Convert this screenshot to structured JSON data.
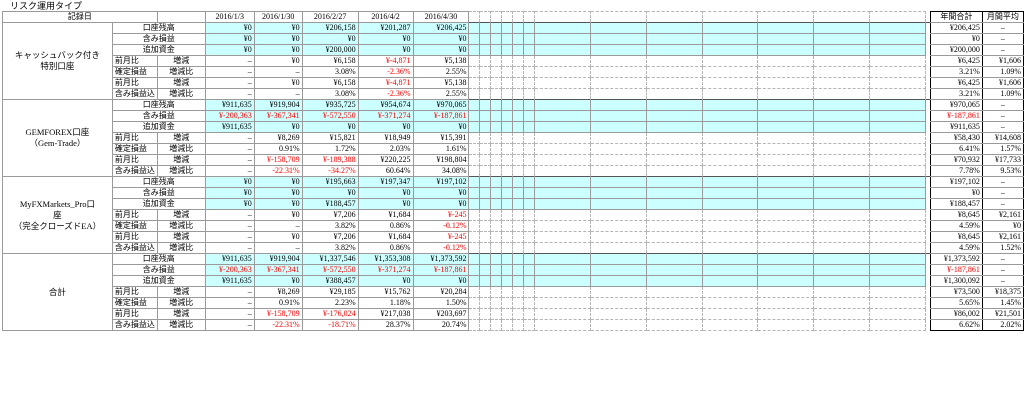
{
  "sheet_title": "リスク運用タイプ",
  "header": {
    "record_date_label": "記録日",
    "dates": [
      "2016/1/3",
      "2016/1/30",
      "2016/2/27",
      "2016/4/2",
      "2016/4/30"
    ],
    "annual_total": "年間合計",
    "monthly_avg": "月間平均"
  },
  "groups": [
    {
      "name": "キャッシュバック付き\n特別口座",
      "rows": [
        {
          "label": "口座残高",
          "cells": [
            "¥0",
            "¥0",
            "¥206,158",
            "¥201,287",
            "¥206,425"
          ],
          "total": "¥206,425",
          "avg": "–"
        },
        {
          "label": "含み損益",
          "cells": [
            "¥0",
            "¥0",
            "¥0",
            "¥0",
            "¥0"
          ],
          "total": "¥0",
          "avg": "–"
        },
        {
          "label": "追加資金",
          "cells": [
            "¥0",
            "¥0",
            "¥200,000",
            "¥0",
            "¥0"
          ],
          "total": "¥200,000",
          "avg": "–"
        },
        {
          "l1": "前月比",
          "l2": "増減",
          "cells": [
            "–",
            "¥0",
            "¥6,158",
            "¥-4,871",
            "¥5,138"
          ],
          "total": "¥6,425",
          "avg": "¥1,606"
        },
        {
          "l1": "確定損益",
          "l2": "増減比",
          "cells": [
            "–",
            "–",
            "3.08%",
            "-2.36%",
            "2.55%"
          ],
          "total": "3.21%",
          "avg": "1.09%"
        },
        {
          "l1": "前月比",
          "l2": "増減",
          "cells": [
            "–",
            "¥0",
            "¥6,158",
            "¥-4,871",
            "¥5,138"
          ],
          "total": "¥6,425",
          "avg": "¥1,606"
        },
        {
          "l1": "含み損益込",
          "l2": "増減比",
          "cells": [
            "–",
            "–",
            "3.08%",
            "-2.36%",
            "2.55%"
          ],
          "total": "3.21%",
          "avg": "1.09%"
        }
      ]
    },
    {
      "name": "GEMFOREX口座\n（Gem-Trade）",
      "rows": [
        {
          "label": "口座残高",
          "cells": [
            "¥911,635",
            "¥919,904",
            "¥935,725",
            "¥954,674",
            "¥970,065"
          ],
          "total": "¥970,065",
          "avg": "–"
        },
        {
          "label": "含み損益",
          "cells": [
            "¥-200,363",
            "¥-367,341",
            "¥-572,550",
            "¥-371,274",
            "¥-187,861"
          ],
          "total": "¥-187,861",
          "avg": "–"
        },
        {
          "label": "追加資金",
          "cells": [
            "¥911,635",
            "¥0",
            "¥0",
            "¥0",
            "¥0"
          ],
          "total": "¥911,635",
          "avg": "–"
        },
        {
          "l1": "前月比",
          "l2": "増減",
          "cells": [
            "–",
            "¥8,269",
            "¥15,821",
            "¥18,949",
            "¥15,391"
          ],
          "total": "¥58,430",
          "avg": "¥14,608"
        },
        {
          "l1": "確定損益",
          "l2": "増減比",
          "cells": [
            "–",
            "0.91%",
            "1.72%",
            "2.03%",
            "1.61%"
          ],
          "total": "6.41%",
          "avg": "1.57%"
        },
        {
          "l1": "前月比",
          "l2": "増減",
          "cells": [
            "–",
            "¥-158,709",
            "¥-189,388",
            "¥220,225",
            "¥198,804"
          ],
          "total": "¥70,932",
          "avg": "¥17,733"
        },
        {
          "l1": "含み損益込",
          "l2": "増減比",
          "cells": [
            "–",
            "-22.31%",
            "-34.27%",
            "60.64%",
            "34.08%"
          ],
          "total": "7.78%",
          "avg": "9.53%"
        }
      ]
    },
    {
      "name": "MyFXMarkets_Pro口\n座\n（完全クローズドEA）",
      "rows": [
        {
          "label": "口座残高",
          "cells": [
            "¥0",
            "¥0",
            "¥195,663",
            "¥197,347",
            "¥197,102"
          ],
          "total": "¥197,102",
          "avg": "–"
        },
        {
          "label": "含み損益",
          "cells": [
            "¥0",
            "¥0",
            "¥0",
            "¥0",
            "¥0"
          ],
          "total": "¥0",
          "avg": "–"
        },
        {
          "label": "追加資金",
          "cells": [
            "¥0",
            "¥0",
            "¥188,457",
            "¥0",
            "¥0"
          ],
          "total": "¥188,457",
          "avg": "–"
        },
        {
          "l1": "前月比",
          "l2": "増減",
          "cells": [
            "–",
            "¥0",
            "¥7,206",
            "¥1,684",
            "¥-245"
          ],
          "total": "¥8,645",
          "avg": "¥2,161"
        },
        {
          "l1": "確定損益",
          "l2": "増減比",
          "cells": [
            "–",
            "–",
            "3.82%",
            "0.86%",
            "-0.12%"
          ],
          "total": "4.59%",
          "avg": "¥0"
        },
        {
          "l1": "前月比",
          "l2": "増減",
          "cells": [
            "–",
            "¥0",
            "¥7,206",
            "¥1,684",
            "¥-245"
          ],
          "total": "¥8,645",
          "avg": "¥2,161"
        },
        {
          "l1": "含み損益込",
          "l2": "増減比",
          "cells": [
            "–",
            "–",
            "3.82%",
            "0.86%",
            "-0.12%"
          ],
          "total": "4.59%",
          "avg": "1.52%"
        }
      ]
    },
    {
      "name": "合計",
      "rows": [
        {
          "label": "口座残高",
          "cells": [
            "¥911,635",
            "¥919,904",
            "¥1,337,546",
            "¥1,353,308",
            "¥1,373,592"
          ],
          "total": "¥1,373,592",
          "avg": "–"
        },
        {
          "label": "含み損益",
          "cells": [
            "¥-200,363",
            "¥-367,341",
            "¥-572,550",
            "¥-371,274",
            "¥-187,861"
          ],
          "total": "¥-187,861",
          "avg": "–"
        },
        {
          "label": "追加資金",
          "cells": [
            "¥911,635",
            "¥0",
            "¥388,457",
            "¥0",
            "¥0"
          ],
          "total": "¥1,300,092",
          "avg": "–"
        },
        {
          "l1": "前月比",
          "l2": "増減",
          "cells": [
            "–",
            "¥8,269",
            "¥29,185",
            "¥15,762",
            "¥20,284"
          ],
          "total": "¥73,500",
          "avg": "¥18,375"
        },
        {
          "l1": "確定損益",
          "l2": "増減比",
          "cells": [
            "–",
            "0.91%",
            "2.23%",
            "1.18%",
            "1.50%"
          ],
          "total": "5.65%",
          "avg": "1.45%"
        },
        {
          "l1": "前月比",
          "l2": "増減",
          "cells": [
            "–",
            "¥-158,709",
            "¥-176,024",
            "¥217,038",
            "¥203,697"
          ],
          "total": "¥86,002",
          "avg": "¥21,501"
        },
        {
          "l1": "含み損益込",
          "l2": "増減比",
          "cells": [
            "–",
            "-22.31%",
            "-18.71%",
            "28.37%",
            "20.74%"
          ],
          "total": "6.62%",
          "avg": "2.02%"
        }
      ]
    }
  ],
  "colors": {
    "cyan_fill": "#ccffff",
    "negative": "#ff0000"
  }
}
